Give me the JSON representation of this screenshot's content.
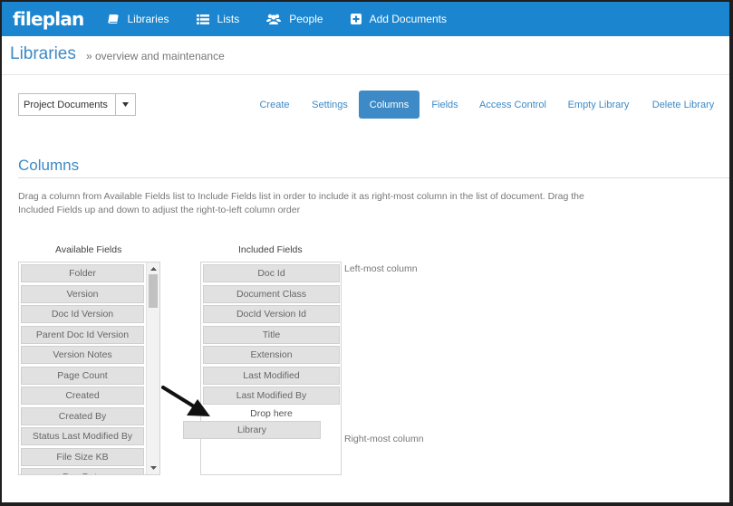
{
  "app": {
    "logo": "fileplan"
  },
  "nav": {
    "libraries": "Libraries",
    "lists": "Lists",
    "people": "People",
    "add_documents": "Add Documents"
  },
  "header": {
    "title": "Libraries",
    "subtitle": "» overview and maintenance"
  },
  "library_select": {
    "value": "Project Documents"
  },
  "toolbar": {
    "create": "Create",
    "settings": "Settings",
    "columns": "Columns",
    "fields": "Fields",
    "access_control": "Access Control",
    "empty_library": "Empty Library",
    "delete_library": "Delete Library",
    "active": "Columns"
  },
  "section": {
    "title": "Columns",
    "description": "Drag a column from Available Fields list to Include Fields list in order to include it as right-most column in the list of document. Drag the Included Fields up and down to adjust the right-to-left column order"
  },
  "available": {
    "header": "Available Fields",
    "items": [
      "Folder",
      "Version",
      "Doc Id Version",
      "Parent Doc Id Version",
      "Version Notes",
      "Page Count",
      "Created",
      "Created By",
      "Status Last Modified By",
      "File Size KB",
      "Doc Date"
    ]
  },
  "included": {
    "header": "Included Fields",
    "items": [
      "Doc Id",
      "Document Class",
      "DocId Version Id",
      "Title",
      "Extension",
      "Last Modified",
      "Last Modified By"
    ],
    "drop_hint": "Drop here",
    "dragging": "Library",
    "left_label": "Left-most column",
    "right_label": "Right-most column"
  },
  "colors": {
    "brand": "#1b86cf",
    "accent": "#3d8ac6",
    "field_bg": "#e1e1e1"
  }
}
